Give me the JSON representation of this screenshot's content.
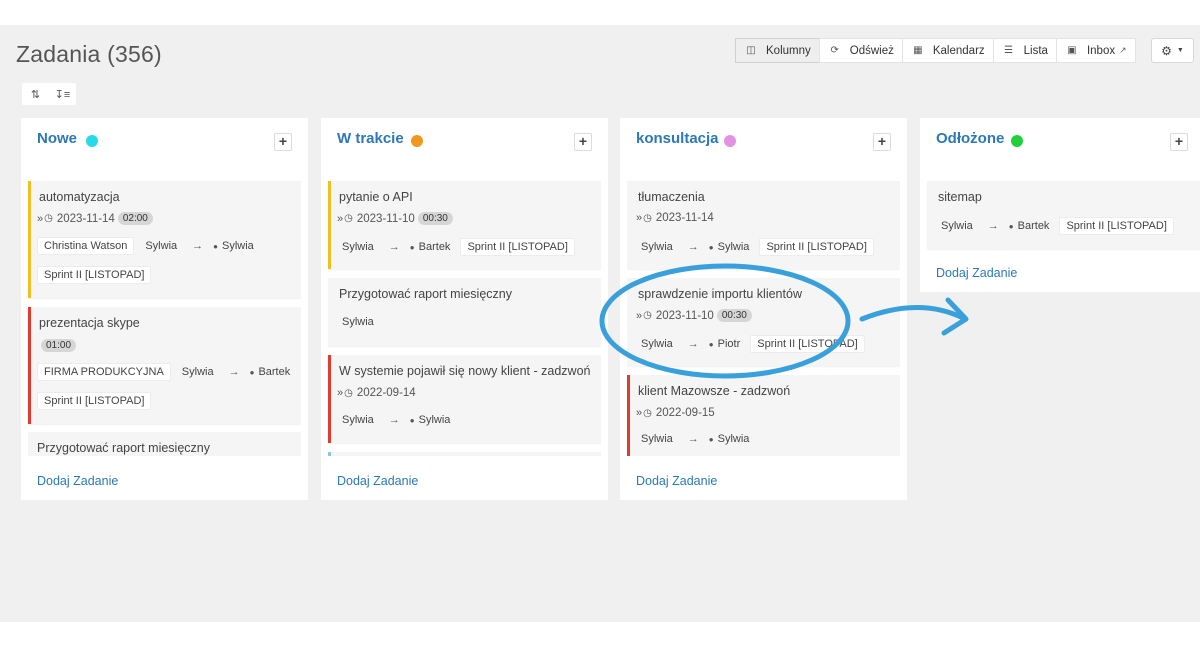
{
  "page": {
    "title": "Zadania (356)"
  },
  "toolbar": {
    "kolumny": "Kolumny",
    "odswiez": "Odśwież",
    "kalendarz": "Kalendarz",
    "lista": "Lista",
    "inbox": "Inbox"
  },
  "sort": {
    "asc_icon": "sort-amount-down-icon",
    "desc_icon": "sort-amount-desc-icon"
  },
  "columns": [
    {
      "title": "Nowe",
      "dot_color": "#28d9e6",
      "add_task": "Dodaj Zadanie",
      "cards": [
        {
          "title": "automatyzacja",
          "date": "2023-11-14",
          "duration": "02:00",
          "tag1": "Christina Watson",
          "from": "Sylwia",
          "to": "Sylwia",
          "sprint": "Sprint II [LISTOPAD]",
          "border": "#f0c020"
        },
        {
          "title": "prezentacja skype",
          "duration": "01:00",
          "tag1": "FIRMA PRODUKCYJNA",
          "from": "Sylwia",
          "to": "Bartek",
          "sprint": "Sprint II [LISTOPAD]",
          "border": "#e23a2c"
        },
        {
          "title": "Przygotować raport miesięczny"
        }
      ]
    },
    {
      "title": "W trakcie",
      "dot_color": "#ef9820",
      "add_task": "Dodaj Zadanie",
      "cards": [
        {
          "title": "pytanie o API",
          "date": "2023-11-10",
          "duration": "00:30",
          "from": "Sylwia",
          "to": "Bartek",
          "sprint": "Sprint II [LISTOPAD]",
          "border": "#f0c020"
        },
        {
          "title": "Przygotować raport miesięczny",
          "from": "Sylwia"
        },
        {
          "title": "W systemie pojawił się nowy klient - zadzwoń",
          "date": "2022-09-14",
          "from": "Sylwia",
          "to": "Sylwia",
          "border": "#e23a2c"
        }
      ]
    },
    {
      "title": "konsultacja",
      "dot_color": "#e392e1",
      "add_task": "Dodaj Zadanie",
      "cards": [
        {
          "title": "tłumaczenia",
          "date": "2023-11-14",
          "from": "Sylwia",
          "to": "Sylwia",
          "sprint": "Sprint II [LISTOPAD]"
        },
        {
          "title": "sprawdzenie importu klientów",
          "date": "2023-11-10",
          "duration": "00:30",
          "from": "Sylwia",
          "to": "Piotr",
          "sprint": "Sprint II [LISTOPAD]"
        },
        {
          "title": "klient Mazowsze - zadzwoń",
          "date": "2022-09-15",
          "from": "Sylwia",
          "to": "Sylwia",
          "border": "#e23a2c"
        }
      ]
    },
    {
      "title": "Odłożone",
      "dot_color": "#22d03a",
      "add_task": "Dodaj Zadanie",
      "cards": [
        {
          "title": "sitemap",
          "from": "Sylwia",
          "to": "Bartek",
          "sprint": "Sprint II [LISTOPAD]"
        }
      ]
    }
  ],
  "annotation_color": "#3aa0dc"
}
